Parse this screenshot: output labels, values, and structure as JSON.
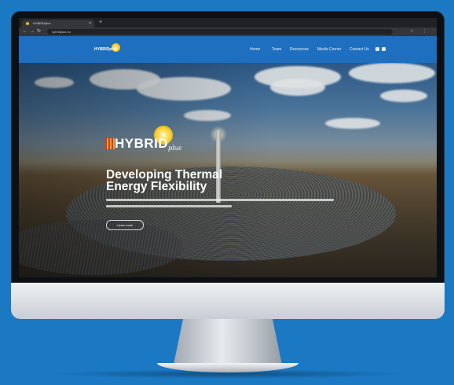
{
  "browser": {
    "tab_title": "HYBRIDplus",
    "tab_close": "×",
    "new_tab": "+",
    "url": "hybridplus.eu",
    "nav_back": "←",
    "nav_forward": "→",
    "nav_reload": "↻",
    "actions": [
      "☆",
      "⋮"
    ]
  },
  "header": {
    "logo_text": "HYBRIDplus",
    "nav": [
      "Home",
      "Team",
      "Resources",
      "Media Corner",
      "Contact Us"
    ],
    "social_icons": [
      "twitter-icon",
      "linkedin-icon"
    ]
  },
  "hero": {
    "brand_word": "HYBRID",
    "brand_suffix": "plus",
    "headline_line1": "Developing Thermal",
    "headline_line2": "Energy Flexibility",
    "cta_label": "Learn more"
  },
  "colors": {
    "background": "#1b79c4",
    "header": "#1e6fc0",
    "sun": "#f6c21a"
  }
}
